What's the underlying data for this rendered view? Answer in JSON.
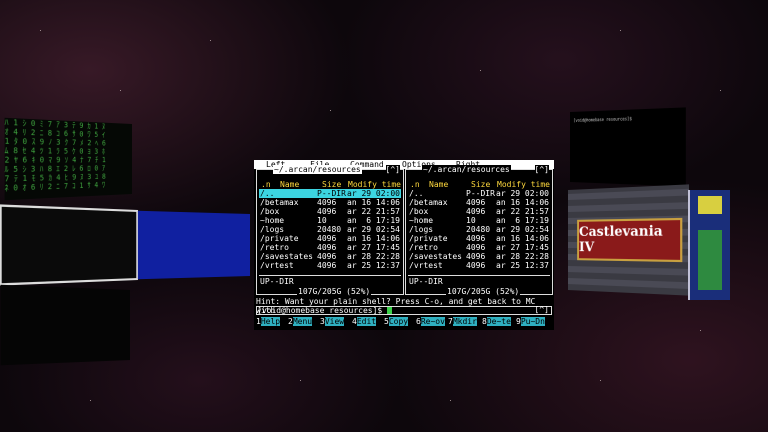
{
  "mc": {
    "menu": [
      "Left",
      "File",
      "Command",
      "Options",
      "Right"
    ],
    "left_panel": {
      "title": "~/.arcan/resources",
      "button": "[^]",
      "headers": {
        "sort": ".n",
        "name": "Name",
        "size": "Size",
        "mtime": "Modify time"
      },
      "entries": [
        {
          "name": "/..",
          "size": "P--DIR",
          "mtime": "ar 29 02:00",
          "selected": true
        },
        {
          "name": "/betamax",
          "size": "4096",
          "mtime": "an 16 14:06"
        },
        {
          "name": "/box",
          "size": "4096",
          "mtime": "ar 22 21:57"
        },
        {
          "name": "~home",
          "size": "10",
          "mtime": "an  6 17:19"
        },
        {
          "name": "/logs",
          "size": "20480",
          "mtime": "ar 29 02:54"
        },
        {
          "name": "/private",
          "size": "4096",
          "mtime": "an 16 14:06"
        },
        {
          "name": "/retro",
          "size": "4096",
          "mtime": "ar 27 17:45"
        },
        {
          "name": "/savestates",
          "size": "4096",
          "mtime": "ar 28 22:28"
        },
        {
          "name": "/vrtest",
          "size": "4096",
          "mtime": "ar 25 12:37"
        }
      ],
      "footer": "UP--DIR",
      "free": "107G/205G (52%)"
    },
    "right_panel": {
      "title": "~/.arcan/resources",
      "button": "[^]",
      "headers": {
        "sort": ".n",
        "name": "Name",
        "size": "Size",
        "mtime": "Modify time"
      },
      "entries": [
        {
          "name": "/..",
          "size": "P--DIR",
          "mtime": "ar 29 02:00"
        },
        {
          "name": "/betamax",
          "size": "4096",
          "mtime": "an 16 14:06"
        },
        {
          "name": "/box",
          "size": "4096",
          "mtime": "ar 22 21:57"
        },
        {
          "name": "~home",
          "size": "10",
          "mtime": "an  6 17:19"
        },
        {
          "name": "/logs",
          "size": "20480",
          "mtime": "ar 29 02:54"
        },
        {
          "name": "/private",
          "size": "4096",
          "mtime": "an 16 14:06"
        },
        {
          "name": "/retro",
          "size": "4096",
          "mtime": "ar 27 17:45"
        },
        {
          "name": "/savestates",
          "size": "4096",
          "mtime": "ar 28 22:28"
        },
        {
          "name": "/vrtest",
          "size": "4096",
          "mtime": "ar 25 12:37"
        }
      ],
      "footer": "UP--DIR",
      "free": "107G/205G (52%)"
    },
    "hint": "Hint: Want your plain shell? Press C-o, and get back to MC with",
    "prompt": "[void@homebase resources]$ ",
    "prompt_button": "[^]",
    "fkeys": [
      {
        "num": "1",
        "label": "Help"
      },
      {
        "num": "2",
        "label": "Menu"
      },
      {
        "num": "3",
        "label": "View"
      },
      {
        "num": "4",
        "label": "Edit"
      },
      {
        "num": "5",
        "label": "Copy"
      },
      {
        "num": "6",
        "label": "Re~ov"
      },
      {
        "num": "7",
        "label": "Mkdir"
      },
      {
        "num": "8",
        "label": "De~te"
      },
      {
        "num": "9",
        "label": "Pu~Dn"
      }
    ]
  },
  "background_windows": {
    "right_terminal_text": "[void@homebase resources]$ ",
    "game_title": "Castlevania IV"
  },
  "colors": {
    "selection": "#3cd4e0",
    "header": "#ffd93d",
    "fkey_label": "#2fb0c0",
    "cursor": "#3cd04a"
  }
}
